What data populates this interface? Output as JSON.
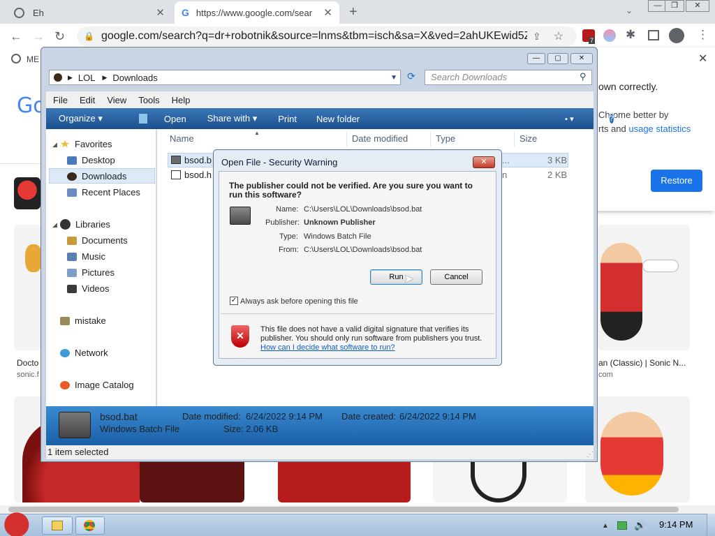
{
  "browser": {
    "tabs": [
      {
        "label": "Eh",
        "icon": "globe-icon"
      },
      {
        "label": "https://www.google.com/sear",
        "icon": "google-icon"
      }
    ],
    "new_tab": "+",
    "url": "google.com/search?q=dr+robotnik&source=lnms&tbm=isch&sa=X&ved=2ahUKEwid5Z...",
    "extension_badge": "7",
    "bookmark_label": "ME"
  },
  "google": {
    "logo_partial": "Go",
    "captions": [
      {
        "title": "Docto",
        "source": "sonic.f"
      },
      {
        "title": "an (Classic) | Sonic N...",
        "source": "com"
      }
    ]
  },
  "restore_popup": {
    "line1": "own correctly.",
    "line2": "Chrome better by",
    "line3_prefix": "rts and ",
    "line3_link": "usage statistics",
    "button": "Restore"
  },
  "explorer": {
    "breadcrumb": [
      "LOL",
      "Downloads"
    ],
    "search_placeholder": "Search Downloads",
    "menu": [
      "File",
      "Edit",
      "View",
      "Tools",
      "Help"
    ],
    "commands": [
      "Organize ▾",
      "Open",
      "Share with ▾",
      "Print",
      "New folder"
    ],
    "nav": {
      "favorites": "Favorites",
      "desktop": "Desktop",
      "downloads": "Downloads",
      "recent": "Recent Places",
      "libraries": "Libraries",
      "documents": "Documents",
      "music": "Music",
      "pictures": "Pictures",
      "videos": "Videos",
      "mistake": "mistake",
      "network": "Network",
      "image_catalog": "Image Catalog"
    },
    "columns": [
      "Name",
      "Date modified",
      "Type",
      "Size"
    ],
    "files": [
      {
        "name": "bsod.b",
        "type_partial": "...",
        "size": "3 KB"
      },
      {
        "name": "bsod.h",
        "type_partial": "n",
        "size": "2 KB"
      }
    ],
    "details": {
      "filename": "bsod.bat",
      "filetype": "Windows Batch File",
      "modified_label": "Date modified:",
      "modified": "6/24/2022 9:14 PM",
      "created_label": "Date created:",
      "created": "6/24/2022 9:14 PM",
      "size_label": "Size:",
      "size": "2.06 KB"
    },
    "status": "1 item selected"
  },
  "dialog": {
    "title": "Open File - Security Warning",
    "question": "The publisher could not be verified.  Are you sure you want to run this software?",
    "fields": [
      {
        "label": "Name:",
        "value": "C:\\Users\\LOL\\Downloads\\bsod.bat"
      },
      {
        "label": "Publisher:",
        "value": "Unknown Publisher"
      },
      {
        "label": "Type:",
        "value": "Windows Batch File"
      },
      {
        "label": "From:",
        "value": "C:\\Users\\LOL\\Downloads\\bsod.bat"
      }
    ],
    "run_button": "Run",
    "cancel_button": "Cancel",
    "checkbox_label": "Always ask before opening this file",
    "warning_text": "This file does not have a valid digital signature that verifies its publisher.  You should only run software from publishers you trust.",
    "help_link": "How can I decide what software to run?"
  },
  "taskbar": {
    "clock": "9:14 PM"
  }
}
